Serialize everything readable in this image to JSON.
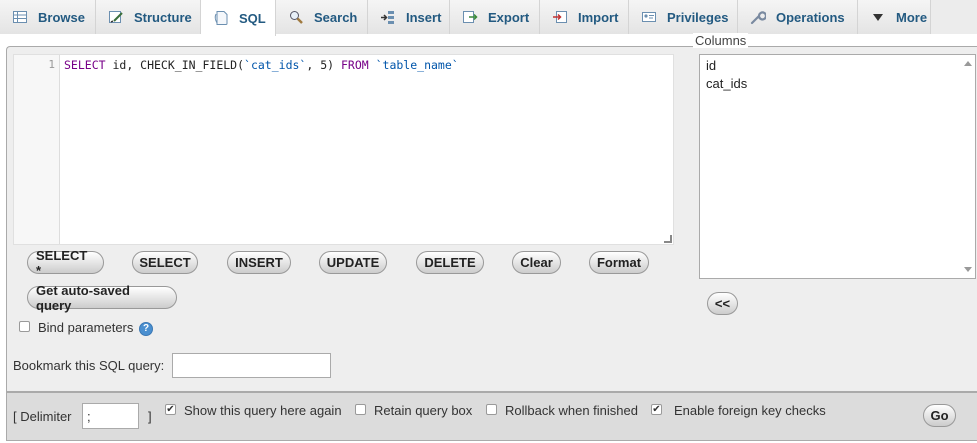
{
  "tabs": [
    {
      "label": "Browse",
      "icon": "browse-icon"
    },
    {
      "label": "Structure",
      "icon": "structure-icon"
    },
    {
      "label": "SQL",
      "icon": "sql-icon",
      "active": true
    },
    {
      "label": "Search",
      "icon": "search-icon"
    },
    {
      "label": "Insert",
      "icon": "insert-icon"
    },
    {
      "label": "Export",
      "icon": "export-icon"
    },
    {
      "label": "Import",
      "icon": "import-icon"
    },
    {
      "label": "Privileges",
      "icon": "privileges-icon"
    },
    {
      "label": "Operations",
      "icon": "operations-icon"
    },
    {
      "label": "More",
      "icon": "chevron-down-icon"
    }
  ],
  "editor": {
    "line_number": "1",
    "query": {
      "kw_select": "SELECT",
      "part1": " id, CHECK_IN_FIELD(",
      "ident1": "`cat_ids`",
      "part2": ", 5) ",
      "kw_from": "FROM",
      "part3": " ",
      "ident2": "`table_name`"
    }
  },
  "query_buttons": {
    "select_star": "SELECT *",
    "select": "SELECT",
    "insert": "INSERT",
    "update": "UPDATE",
    "delete": "DELETE",
    "clear": "Clear",
    "format": "Format",
    "autosaved": "Get auto-saved query"
  },
  "bind_parameters": {
    "label": "Bind parameters",
    "checked": false,
    "help": "?"
  },
  "bookmark": {
    "label": "Bookmark this SQL query:",
    "value": ""
  },
  "columns": {
    "label": "Columns",
    "items": [
      "id",
      "cat_ids"
    ],
    "insert_button": "<<"
  },
  "footer": {
    "delimiter_open": "[ Delimiter",
    "delimiter_value": ";",
    "delimiter_close": "]",
    "show_query": {
      "label": "Show this query here again",
      "checked": true
    },
    "retain_box": {
      "label": "Retain query box",
      "checked": false
    },
    "rollback": {
      "label": "Rollback when finished",
      "checked": false
    },
    "foreign_keys": {
      "label": "Enable foreign key checks",
      "checked": true
    },
    "go": "Go"
  },
  "colors": {
    "tab_text": "#235a81",
    "keyword": "#770088",
    "identifier": "#0055aa"
  }
}
